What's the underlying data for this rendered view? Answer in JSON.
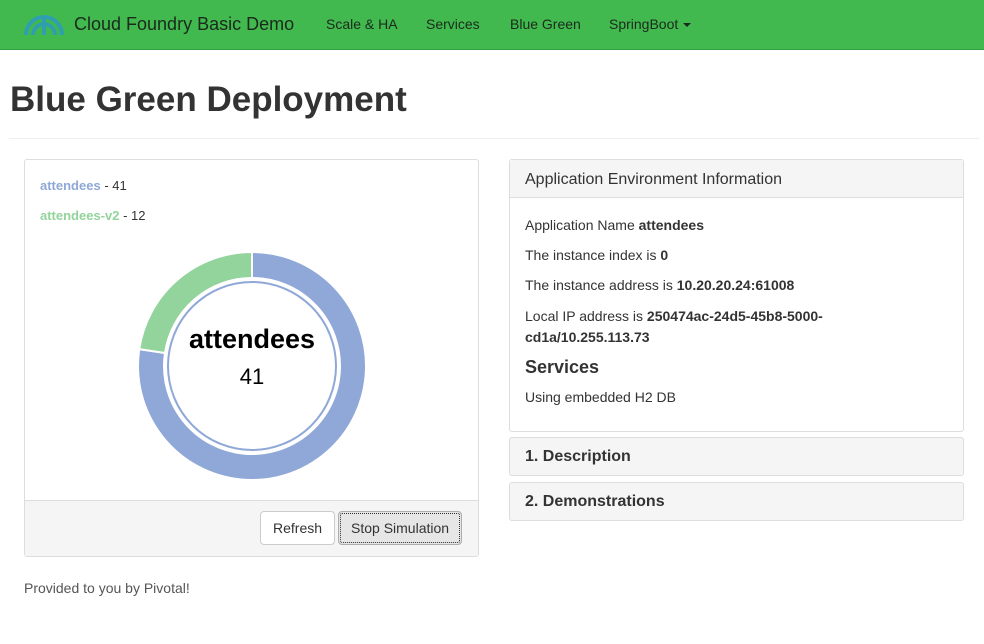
{
  "navbar": {
    "brand": "Cloud Foundry Basic Demo",
    "links": [
      "Scale & HA",
      "Services",
      "Blue Green",
      "SpringBoot"
    ],
    "logo_icon": "cloud-foundry-logo-icon",
    "color": "#41b94e"
  },
  "page": {
    "title": "Blue Green Deployment"
  },
  "chart": {
    "legend": [
      {
        "name": "attendees",
        "value_text": " - 41",
        "color": "#8fa8d8"
      },
      {
        "name": "attendees-v2",
        "value_text": " - 12",
        "color": "#92d49c"
      }
    ],
    "center_label": "attendees",
    "center_value": "41"
  },
  "chart_data": {
    "type": "pie",
    "categories": [
      "attendees",
      "attendees-v2"
    ],
    "values": [
      41,
      12
    ],
    "colors": [
      "#8fa8d8",
      "#92d49c"
    ],
    "donut": true,
    "highlighted": "attendees"
  },
  "chart_footer": {
    "refresh": "Refresh",
    "stop": "Stop Simulation"
  },
  "env_panel": {
    "heading": "Application Environment Information",
    "app_name_label": "Application Name",
    "app_name": "attendees",
    "index_label": "The instance index is",
    "index": "0",
    "address_label": "The instance address is",
    "address": "10.20.20.24:61008",
    "local_ip_label": "Local IP address is",
    "local_ip_part1": "250474ac-24d5-45b8-5000-",
    "local_ip_part2": "cd1a/10.255.113.73",
    "services_heading": "Services",
    "services_text": "Using embedded H2 DB"
  },
  "accordion": {
    "description": "1. Description",
    "demonstrations": "2. Demonstrations"
  },
  "footer": {
    "text": "Provided to you by Pivotal!"
  }
}
